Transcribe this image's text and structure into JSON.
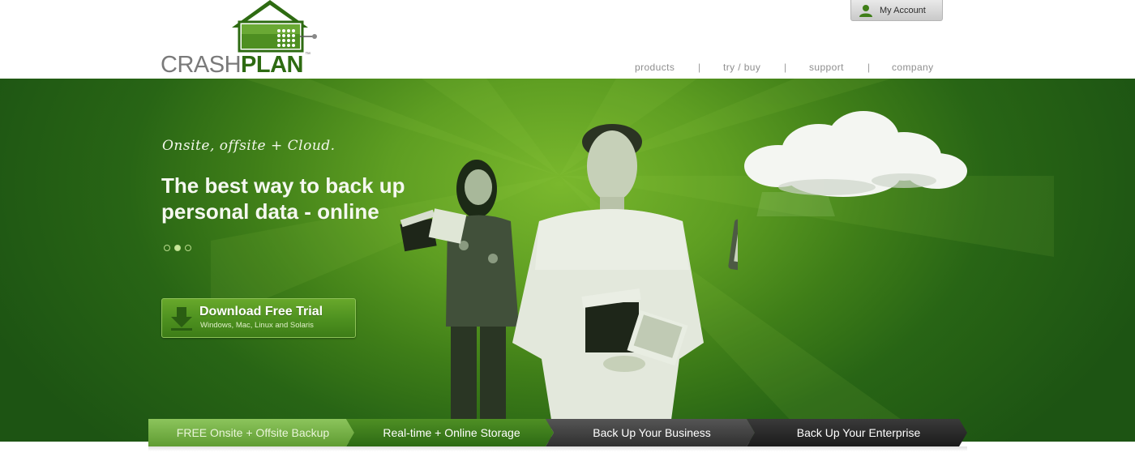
{
  "brand": {
    "name_part1": "CRASH",
    "name_part2": "PLAN",
    "trademark": "™",
    "colors": {
      "green": "#2e6b12",
      "gray": "#7a7a7a"
    }
  },
  "account": {
    "label": "My Account",
    "icon": "user-icon"
  },
  "nav": {
    "items": [
      {
        "label": "products"
      },
      {
        "label": "try / buy"
      },
      {
        "label": "support"
      },
      {
        "label": "company"
      }
    ],
    "separator": "|"
  },
  "hero": {
    "tagline": "Onsite, offsite + Cloud.",
    "headline_line1": "The best way to back up",
    "headline_line2": "personal data - online",
    "slides": {
      "count": 3,
      "active_index": 1
    },
    "cta": {
      "title": "Download Free Trial",
      "subtitle": "Windows, Mac, Linux and Solaris",
      "icon": "download-arrow-icon"
    },
    "colors": {
      "hero_green": "#3f7e18",
      "hero_light": "#7ab82d"
    }
  },
  "tabs": [
    {
      "label": "FREE Onsite + Offsite Backup"
    },
    {
      "label": "Real-time + Online Storage"
    },
    {
      "label": "Back Up Your Business"
    },
    {
      "label": "Back Up Your Enterprise"
    }
  ]
}
